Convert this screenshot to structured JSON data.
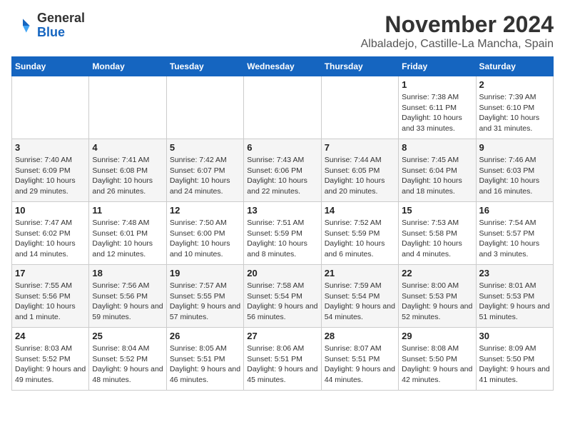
{
  "logo": {
    "general": "General",
    "blue": "Blue"
  },
  "header": {
    "month_year": "November 2024",
    "location": "Albaladejo, Castille-La Mancha, Spain"
  },
  "days_of_week": [
    "Sunday",
    "Monday",
    "Tuesday",
    "Wednesday",
    "Thursday",
    "Friday",
    "Saturday"
  ],
  "weeks": [
    [
      {
        "day": "",
        "info": ""
      },
      {
        "day": "",
        "info": ""
      },
      {
        "day": "",
        "info": ""
      },
      {
        "day": "",
        "info": ""
      },
      {
        "day": "",
        "info": ""
      },
      {
        "day": "1",
        "info": "Sunrise: 7:38 AM\nSunset: 6:11 PM\nDaylight: 10 hours and 33 minutes."
      },
      {
        "day": "2",
        "info": "Sunrise: 7:39 AM\nSunset: 6:10 PM\nDaylight: 10 hours and 31 minutes."
      }
    ],
    [
      {
        "day": "3",
        "info": "Sunrise: 7:40 AM\nSunset: 6:09 PM\nDaylight: 10 hours and 29 minutes."
      },
      {
        "day": "4",
        "info": "Sunrise: 7:41 AM\nSunset: 6:08 PM\nDaylight: 10 hours and 26 minutes."
      },
      {
        "day": "5",
        "info": "Sunrise: 7:42 AM\nSunset: 6:07 PM\nDaylight: 10 hours and 24 minutes."
      },
      {
        "day": "6",
        "info": "Sunrise: 7:43 AM\nSunset: 6:06 PM\nDaylight: 10 hours and 22 minutes."
      },
      {
        "day": "7",
        "info": "Sunrise: 7:44 AM\nSunset: 6:05 PM\nDaylight: 10 hours and 20 minutes."
      },
      {
        "day": "8",
        "info": "Sunrise: 7:45 AM\nSunset: 6:04 PM\nDaylight: 10 hours and 18 minutes."
      },
      {
        "day": "9",
        "info": "Sunrise: 7:46 AM\nSunset: 6:03 PM\nDaylight: 10 hours and 16 minutes."
      }
    ],
    [
      {
        "day": "10",
        "info": "Sunrise: 7:47 AM\nSunset: 6:02 PM\nDaylight: 10 hours and 14 minutes."
      },
      {
        "day": "11",
        "info": "Sunrise: 7:48 AM\nSunset: 6:01 PM\nDaylight: 10 hours and 12 minutes."
      },
      {
        "day": "12",
        "info": "Sunrise: 7:50 AM\nSunset: 6:00 PM\nDaylight: 10 hours and 10 minutes."
      },
      {
        "day": "13",
        "info": "Sunrise: 7:51 AM\nSunset: 5:59 PM\nDaylight: 10 hours and 8 minutes."
      },
      {
        "day": "14",
        "info": "Sunrise: 7:52 AM\nSunset: 5:59 PM\nDaylight: 10 hours and 6 minutes."
      },
      {
        "day": "15",
        "info": "Sunrise: 7:53 AM\nSunset: 5:58 PM\nDaylight: 10 hours and 4 minutes."
      },
      {
        "day": "16",
        "info": "Sunrise: 7:54 AM\nSunset: 5:57 PM\nDaylight: 10 hours and 3 minutes."
      }
    ],
    [
      {
        "day": "17",
        "info": "Sunrise: 7:55 AM\nSunset: 5:56 PM\nDaylight: 10 hours and 1 minute."
      },
      {
        "day": "18",
        "info": "Sunrise: 7:56 AM\nSunset: 5:56 PM\nDaylight: 9 hours and 59 minutes."
      },
      {
        "day": "19",
        "info": "Sunrise: 7:57 AM\nSunset: 5:55 PM\nDaylight: 9 hours and 57 minutes."
      },
      {
        "day": "20",
        "info": "Sunrise: 7:58 AM\nSunset: 5:54 PM\nDaylight: 9 hours and 56 minutes."
      },
      {
        "day": "21",
        "info": "Sunrise: 7:59 AM\nSunset: 5:54 PM\nDaylight: 9 hours and 54 minutes."
      },
      {
        "day": "22",
        "info": "Sunrise: 8:00 AM\nSunset: 5:53 PM\nDaylight: 9 hours and 52 minutes."
      },
      {
        "day": "23",
        "info": "Sunrise: 8:01 AM\nSunset: 5:53 PM\nDaylight: 9 hours and 51 minutes."
      }
    ],
    [
      {
        "day": "24",
        "info": "Sunrise: 8:03 AM\nSunset: 5:52 PM\nDaylight: 9 hours and 49 minutes."
      },
      {
        "day": "25",
        "info": "Sunrise: 8:04 AM\nSunset: 5:52 PM\nDaylight: 9 hours and 48 minutes."
      },
      {
        "day": "26",
        "info": "Sunrise: 8:05 AM\nSunset: 5:51 PM\nDaylight: 9 hours and 46 minutes."
      },
      {
        "day": "27",
        "info": "Sunrise: 8:06 AM\nSunset: 5:51 PM\nDaylight: 9 hours and 45 minutes."
      },
      {
        "day": "28",
        "info": "Sunrise: 8:07 AM\nSunset: 5:51 PM\nDaylight: 9 hours and 44 minutes."
      },
      {
        "day": "29",
        "info": "Sunrise: 8:08 AM\nSunset: 5:50 PM\nDaylight: 9 hours and 42 minutes."
      },
      {
        "day": "30",
        "info": "Sunrise: 8:09 AM\nSunset: 5:50 PM\nDaylight: 9 hours and 41 minutes."
      }
    ]
  ]
}
